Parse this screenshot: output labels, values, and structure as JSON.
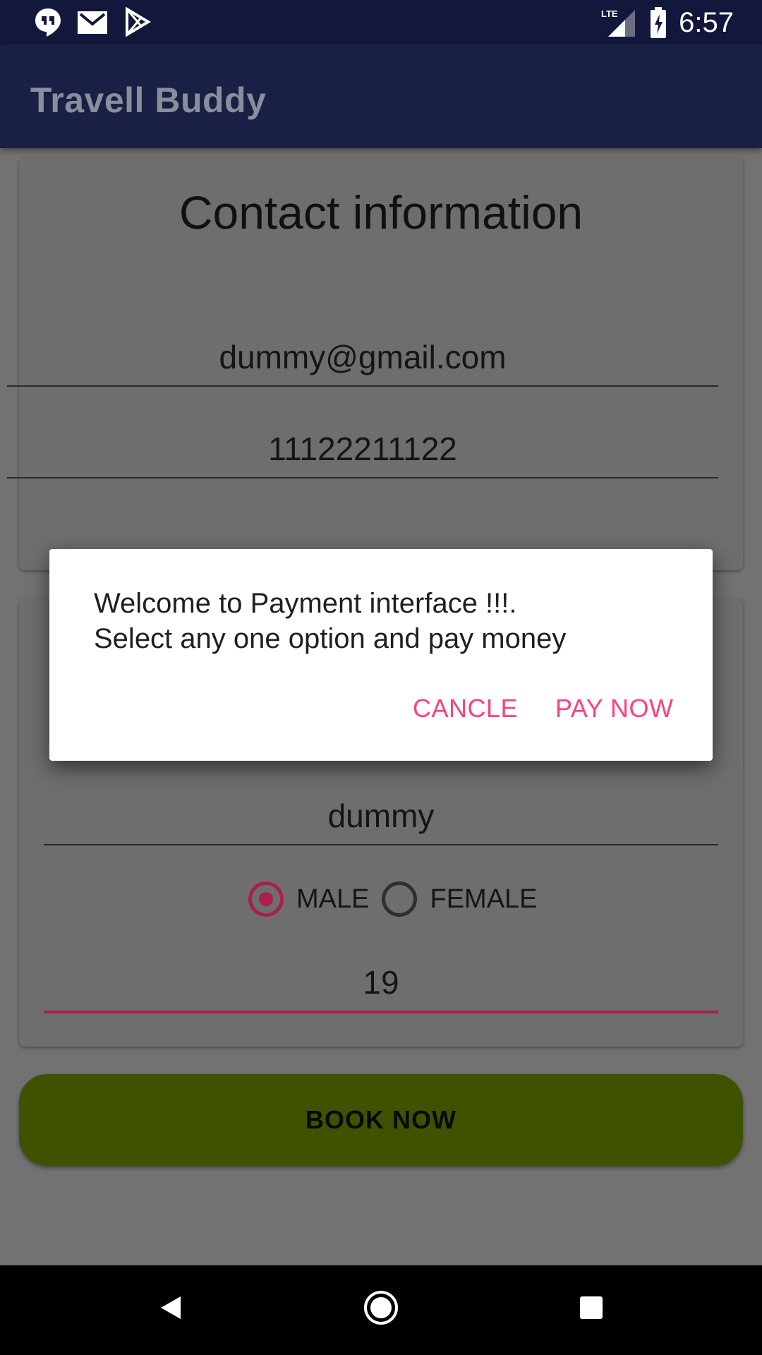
{
  "status_bar": {
    "time": "6:57",
    "left_icons": [
      "hangouts-icon",
      "gmail-icon",
      "play-store-icon"
    ],
    "right_icons": [
      "lte-signal-icon",
      "battery-charging-icon"
    ]
  },
  "app_bar": {
    "title": "Travell Buddy"
  },
  "contact_card": {
    "title": "Contact information",
    "email_value": "dummy@gmail.com",
    "phone_value": "11122211122"
  },
  "traveller_card": {
    "name_value": "dummy",
    "gender_options": [
      {
        "label": "MALE",
        "selected": true
      },
      {
        "label": "FEMALE",
        "selected": false
      }
    ],
    "age_value": "19"
  },
  "book_button": {
    "label": "BOOK NOW"
  },
  "dialog": {
    "message": "Welcome to Payment interface !!!.\nSelect any one option and pay money",
    "cancel_label": "CANCLE",
    "pay_label": "PAY NOW"
  },
  "colors": {
    "status_bar": "#12173b",
    "app_bar": "#1a1f45",
    "accent": "#ff4081",
    "radio_accent": "#a8204f",
    "book_button": "#3e5200"
  },
  "nav_bar": {
    "icons": [
      "back-icon",
      "home-icon",
      "recents-icon"
    ]
  }
}
